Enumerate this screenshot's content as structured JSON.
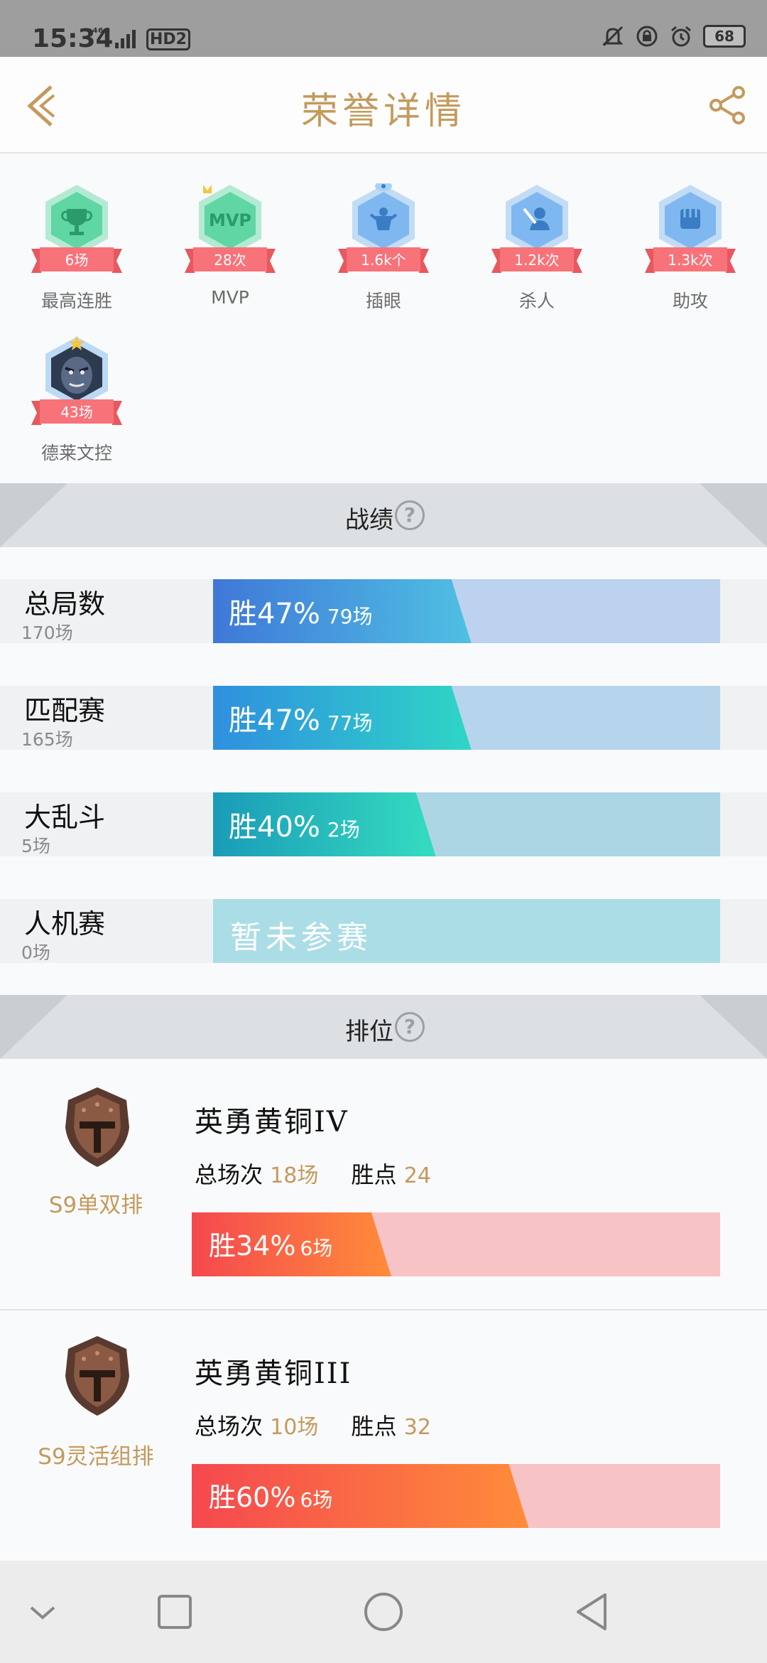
{
  "status_bar": {
    "time": "15:34",
    "network": "⁴⁶ᴳ",
    "hd": "HD2",
    "battery": "68"
  },
  "header": {
    "title": "荣誉详情"
  },
  "honors": [
    {
      "value": "6场",
      "label": "最高连胜",
      "color": "#5fd6a3",
      "icon": "trophy-icon"
    },
    {
      "value": "28次",
      "label": "MVP",
      "color": "#5fd6a3",
      "icon": "mvp-icon"
    },
    {
      "value": "1.6k个",
      "label": "插眼",
      "color": "#7fb8f0",
      "icon": "ward-icon"
    },
    {
      "value": "1.2k次",
      "label": "杀人",
      "color": "#7fb8f0",
      "icon": "kill-icon"
    },
    {
      "value": "1.3k次",
      "label": "助攻",
      "color": "#7fb8f0",
      "icon": "assist-icon"
    },
    {
      "value": "43场",
      "label": "德莱文控",
      "color": "#7fb8f0",
      "icon": "champion-portrait-icon"
    }
  ],
  "record_section": {
    "title": "战绩",
    "help": "?"
  },
  "records": [
    {
      "name": "总局数",
      "count": "170场",
      "win_text": "胜47%",
      "win_games": "79场",
      "win_rate": 0.47,
      "fill_start": "#3f78d8",
      "fill_end": "#4fc0e3",
      "track": "#bcd2ee"
    },
    {
      "name": "匹配赛",
      "count": "165场",
      "win_text": "胜47%",
      "win_games": "77场",
      "win_rate": 0.47,
      "fill_start": "#2f8fe0",
      "fill_end": "#2fd6c6",
      "track": "#b6d5ec"
    },
    {
      "name": "大乱斗",
      "count": "5场",
      "win_text": "胜40%",
      "win_games": "2场",
      "win_rate": 0.4,
      "fill_start": "#1a9bb8",
      "fill_end": "#35dcc0",
      "track": "#acd6e3"
    },
    {
      "name": "人机赛",
      "count": "0场",
      "empty_text": "暂未参赛",
      "win_rate": 0,
      "track": "#abdde6"
    }
  ],
  "rank_section": {
    "title": "排位",
    "help": "?"
  },
  "ranks": [
    {
      "mode": "S9单双排",
      "title": "英勇黄铜IV",
      "total_label": "总场次",
      "total": "18场",
      "points_label": "胜点",
      "points": "24",
      "win_text": "胜34%",
      "win_games": "6场",
      "win_rate": 0.34
    },
    {
      "mode": "S9灵活组排",
      "title": "英勇黄铜III",
      "total_label": "总场次",
      "total": "10场",
      "points_label": "胜点",
      "points": "32",
      "win_text": "胜60%",
      "win_games": "6场",
      "win_rate": 0.6
    }
  ]
}
